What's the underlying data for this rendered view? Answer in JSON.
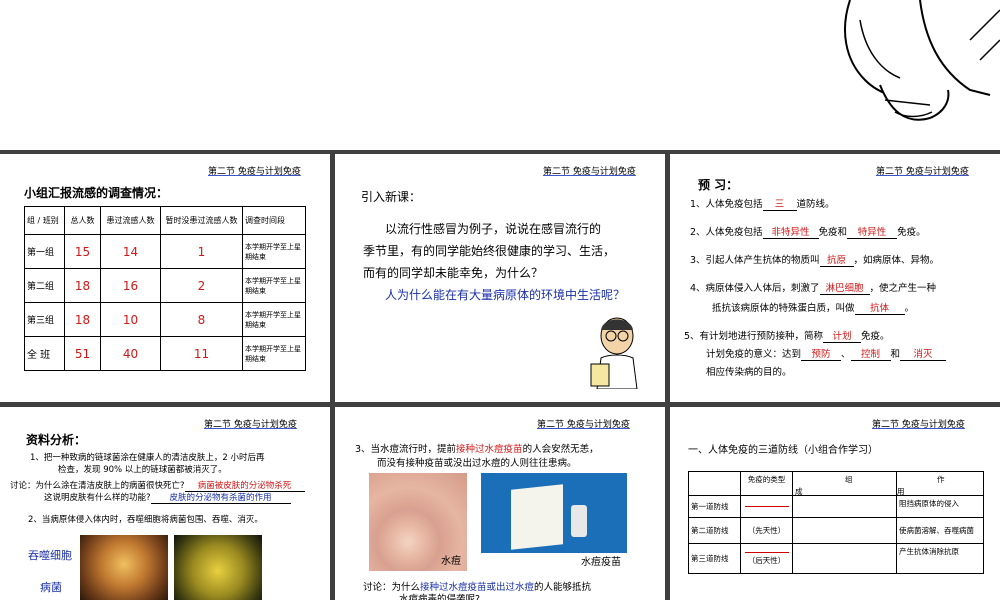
{
  "header": "第二节 免疫与计划免疫",
  "s1": {
    "title": "小组汇报流感的调查情况：",
    "columns": [
      "组 / 班别",
      "总人数",
      "患过流感人数",
      "暂时没患过流感人数",
      "调查时间段"
    ],
    "rows": [
      {
        "group": "第一组",
        "total": "15",
        "sick": "14",
        "healthy": "1",
        "period": "本学期开学至上星期结束"
      },
      {
        "group": "第二组",
        "total": "18",
        "sick": "16",
        "healthy": "2",
        "period": "本学期开学至上星期结束"
      },
      {
        "group": "第三组",
        "total": "18",
        "sick": "10",
        "healthy": "8",
        "period": "本学期开学至上星期结束"
      },
      {
        "group": "全 班",
        "total": "51",
        "sick": "40",
        "healthy": "11",
        "period": "本学期开学至上星期结束"
      }
    ]
  },
  "s2": {
    "title": "引入新课：",
    "l1": "以流行性感冒为例子，说说在感冒流行的",
    "l2": "季节里，有的同学能始终很健康的学习、生活，",
    "l3": "而有的同学却未能幸免，为什么？",
    "q": "人为什么能在有大量病原体的环境中生活呢？"
  },
  "s3": {
    "title": "预 习：",
    "i1a": "1、人体免疫包括",
    "i1b": "三",
    "i1c": "道防线。",
    "i2a": "2、人体免疫包括",
    "i2b": "非特异性",
    "i2c": "免疫和",
    "i2d": "特异性",
    "i2e": "免疫。",
    "i3a": "3、引起人体产生抗体的物质叫",
    "i3b": "抗原",
    "i3c": "，如病原体、异物。",
    "i4a": "4、病原体侵入人体后，刺激了",
    "i4b": "淋巴细胞",
    "i4c": "，使之产生一种",
    "i4d": "抵抗该病原体的特殊蛋白质，叫做",
    "i4e": "抗体",
    "i4f": "。",
    "i5a": "5、有计划地进行预防接种，简称",
    "i5b": "计划",
    "i5c": "免疫。",
    "i6a": "计划免疫的意义：达到",
    "i6b": "预防",
    "i6c": "、",
    "i6d": "控制",
    "i6e": "和",
    "i6f": "消灭",
    "i7": "相应传染病的目的。"
  },
  "s4": {
    "title": "资料分析：",
    "p1a": "1、把一种致病的链球菌涂在健康人的清洁皮肤上，2 小时后再",
    "p1b": "检查，发现 90% 以上的链球菌都被消灭了。",
    "d1a": "讨论：为什么涂在清洁皮肤上的病菌很快死亡?",
    "d1b": "病菌被皮肤的分泌物杀死",
    "d2a": "这说明皮肤有什么样的功能?",
    "d2b": "皮肤的分泌物有杀菌的作用",
    "p2": "2、当病原体侵入体内时，吞噬细胞将病菌包围、吞噬、消灭。",
    "lab1": "吞噬细胞",
    "lab2": "病菌"
  },
  "s5": {
    "t1a": "3、当水痘流行时，提前",
    "t1b": "接种过水痘疫苗",
    "t1c": "的人会安然无恙，",
    "t2": "而没有接种疫苗或没出过水痘的人则往往患病。",
    "img1": "水痘",
    "img2": "水痘疫苗",
    "d1a": "讨论：为什么",
    "d1b": "接种过水痘疫苗或出过水痘",
    "d1c": "的人能够抵抗",
    "d2": "水痘病毒的侵袭呢?"
  },
  "s6": {
    "title": "一、人体免疫的三道防线（小组合作学习）",
    "h1": "免疫的类型",
    "h2": "组",
    "h3": "作",
    "h4": "成",
    "h5": "用",
    "r1": "第一道防线",
    "r1c": "阻挡病原体的侵入",
    "r2": "第二道防线",
    "r2t": "（先天性）",
    "r2c": "使病菌溶解、吞噬病菌",
    "r3": "第三道防线",
    "r3t": "（后天性）",
    "r3c": "产生抗体消除抗原"
  }
}
